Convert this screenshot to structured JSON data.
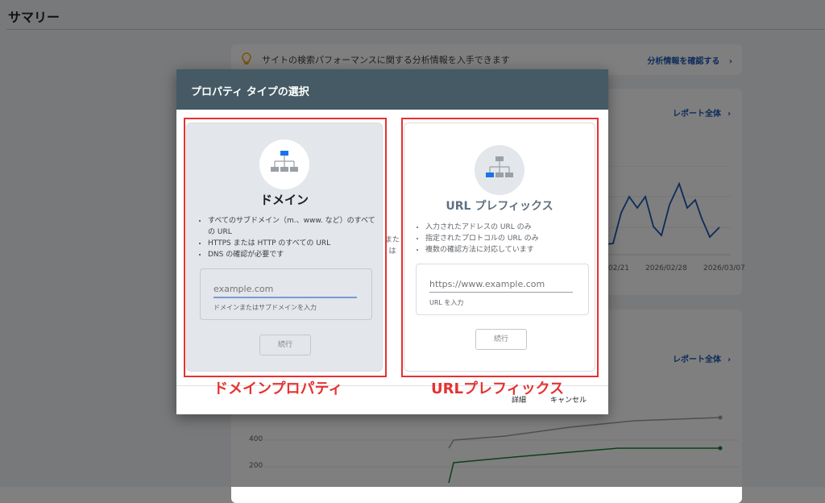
{
  "page": {
    "title": "サマリー"
  },
  "info_banner": {
    "text": "サイトの検索パフォーマンスに関する分析情報を入手できます",
    "link": "分析情報を確認する"
  },
  "report_link": "レポート全体",
  "perf_chart": {
    "x_ticks": [
      "02/21",
      "2026/02/28",
      "2026/03/07"
    ]
  },
  "second_chart": {
    "y_ticks": [
      "400",
      "200"
    ]
  },
  "dialog": {
    "title": "プロパティ タイプの選択",
    "or_text_1": "また",
    "or_text_2": "は",
    "domain": {
      "title": "ドメイン",
      "bullets": [
        "すべてのサブドメイン（m.、www. など）のすべての URL",
        "HTTPS または HTTP のすべての URL",
        "DNS の確認が必要です"
      ],
      "placeholder": "example.com",
      "hint": "ドメインまたはサブドメインを入力",
      "continue": "続行"
    },
    "url_prefix": {
      "title": "URL プレフィックス",
      "bullets": [
        "入力されたアドレスの URL のみ",
        "指定されたプロトコルの URL のみ",
        "複数の確認方法に対応しています"
      ],
      "placeholder": "https://www.example.com",
      "hint": "URL を入力",
      "continue": "続行"
    },
    "footer": {
      "detail": "詳細",
      "cancel": "キャンセル"
    }
  },
  "annotations": {
    "domain_label": "ドメインプロパティ",
    "url_label": "URLプレフィックス",
    "color": "#e63232"
  },
  "colors": {
    "header": "#455a64",
    "accent_blue": "#1a73e8",
    "link_blue": "#1a56b5"
  }
}
